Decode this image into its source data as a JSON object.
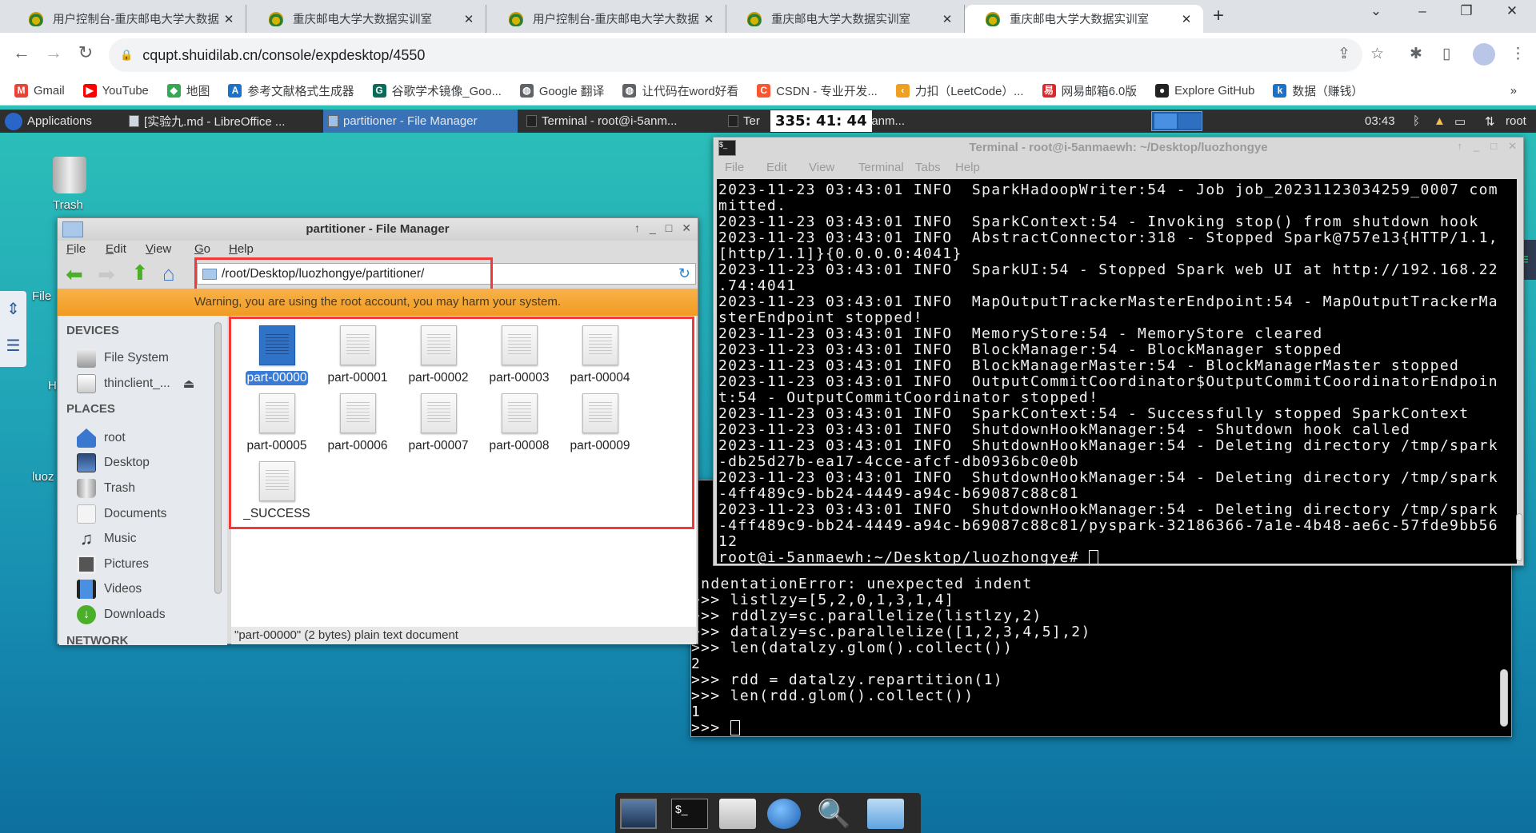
{
  "browser": {
    "tabs": [
      {
        "title": "用户控制台-重庆邮电大学大数据",
        "active": false
      },
      {
        "title": "重庆邮电大学大数据实训室",
        "active": false
      },
      {
        "title": "用户控制台-重庆邮电大学大数据",
        "active": false
      },
      {
        "title": "重庆邮电大学大数据实训室",
        "active": false
      },
      {
        "title": "重庆邮电大学大数据实训室",
        "active": true
      }
    ],
    "new_tab": "+",
    "url": "cqupt.shuidilab.cn/console/expdesktop/4550",
    "bookmarks": [
      {
        "label": "Gmail",
        "icon": "gmail-icon",
        "color": "#ea4335",
        "glyph": "M"
      },
      {
        "label": "YouTube",
        "icon": "youtube-icon",
        "color": "#ff0000",
        "glyph": "▶"
      },
      {
        "label": "地图",
        "icon": "maps-icon",
        "color": "#34a853",
        "glyph": "◆"
      },
      {
        "label": "参考文献格式生成器",
        "icon": "bookmark-a-icon",
        "color": "#1a73c8",
        "glyph": "A"
      },
      {
        "label": "谷歌学术镜像_Goo...",
        "icon": "bookmark-scholar-icon",
        "color": "#0b6b5a",
        "glyph": "G"
      },
      {
        "label": "Google 翻译",
        "icon": "globe-icon",
        "color": "#5f6368",
        "glyph": "◍"
      },
      {
        "label": "让代码在word好看",
        "icon": "globe-icon",
        "color": "#5f6368",
        "glyph": "◍"
      },
      {
        "label": "CSDN - 专业开发...",
        "icon": "csdn-icon",
        "color": "#fc5531",
        "glyph": "C"
      },
      {
        "label": "力扣（LeetCode）...",
        "icon": "leetcode-icon",
        "color": "#f0a020",
        "glyph": "‹"
      },
      {
        "label": "网易邮箱6.0版",
        "icon": "netease-mail-icon",
        "color": "#e0262a",
        "glyph": "易"
      },
      {
        "label": "Explore GitHub",
        "icon": "github-icon",
        "color": "#222222",
        "glyph": "●"
      },
      {
        "label": "数据（赚钱）",
        "icon": "bookmark-k-icon",
        "color": "#1a73c8",
        "glyph": "k"
      }
    ],
    "more_bookmarks": "»"
  },
  "panel": {
    "applications": "Applications",
    "tasks": [
      {
        "label": "[实验九.md - LibreOffice ...",
        "active": false
      },
      {
        "label": "partitioner - File Manager",
        "active": true
      },
      {
        "label": "Terminal - root@i-5anm...",
        "active": false
      },
      {
        "label": "Ter",
        "active": false
      }
    ],
    "task_tail": "-5anm...",
    "timer": "335: 41: 44",
    "clock": "03:43",
    "user": "root"
  },
  "desktop": {
    "icons": [
      {
        "label": "Trash"
      },
      {
        "label": "File"
      },
      {
        "label": "H"
      },
      {
        "label": "luoz"
      }
    ]
  },
  "file_manager": {
    "title": "partitioner - File Manager",
    "menu": [
      "File",
      "Edit",
      "View",
      "Go",
      "Help"
    ],
    "location": "/root/Desktop/luozhongye/partitioner/",
    "warning": "Warning, you are using the root account, you may harm your system.",
    "sidebar": {
      "devices_header": "DEVICES",
      "devices": [
        {
          "label": "File System",
          "icon": "harddisk-icon"
        },
        {
          "label": "thinclient_...",
          "icon": "drive-icon"
        }
      ],
      "places_header": "PLACES",
      "places": [
        {
          "label": "root",
          "icon": "home-icon"
        },
        {
          "label": "Desktop",
          "icon": "desktop-icon"
        },
        {
          "label": "Trash",
          "icon": "trash-icon"
        },
        {
          "label": "Documents",
          "icon": "document-icon"
        },
        {
          "label": "Music",
          "icon": "music-icon"
        },
        {
          "label": "Pictures",
          "icon": "pictures-icon"
        },
        {
          "label": "Videos",
          "icon": "videos-icon"
        },
        {
          "label": "Downloads",
          "icon": "downloads-icon"
        }
      ],
      "network_header": "NETWORK"
    },
    "files": [
      "part-00000",
      "part-00001",
      "part-00002",
      "part-00003",
      "part-00004",
      "part-00005",
      "part-00006",
      "part-00007",
      "part-00008",
      "part-00009",
      "_SUCCESS"
    ],
    "selected_file": "part-00000",
    "status": "\"part-00000\" (2 bytes) plain text document"
  },
  "terminal_front": {
    "title": "Terminal - root@i-5anmaewh: ~/Desktop/luozhongye",
    "menu": [
      "File",
      "Edit",
      "View",
      "Terminal",
      "Tabs",
      "Help"
    ],
    "lines": [
      "2023-11-23 03:43:01 INFO  SparkHadoopWriter:54 - Job job_20231123034259_0007 com",
      "mitted.",
      "2023-11-23 03:43:01 INFO  SparkContext:54 - Invoking stop() from shutdown hook",
      "2023-11-23 03:43:01 INFO  AbstractConnector:318 - Stopped Spark@757e13{HTTP/1.1,",
      "[http/1.1]}{0.0.0.0:4041}",
      "2023-11-23 03:43:01 INFO  SparkUI:54 - Stopped Spark web UI at http://192.168.22",
      ".74:4041",
      "2023-11-23 03:43:01 INFO  MapOutputTrackerMasterEndpoint:54 - MapOutputTrackerMa",
      "sterEndpoint stopped!",
      "2023-11-23 03:43:01 INFO  MemoryStore:54 - MemoryStore cleared",
      "2023-11-23 03:43:01 INFO  BlockManager:54 - BlockManager stopped",
      "2023-11-23 03:43:01 INFO  BlockManagerMaster:54 - BlockManagerMaster stopped",
      "2023-11-23 03:43:01 INFO  OutputCommitCoordinator$OutputCommitCoordinatorEndpoin",
      "t:54 - OutputCommitCoordinator stopped!",
      "2023-11-23 03:43:01 INFO  SparkContext:54 - Successfully stopped SparkContext",
      "2023-11-23 03:43:01 INFO  ShutdownHookManager:54 - Shutdown hook called",
      "2023-11-23 03:43:01 INFO  ShutdownHookManager:54 - Deleting directory /tmp/spark",
      "-db25d27b-ea17-4cce-afcf-db0936bc0e0b",
      "2023-11-23 03:43:01 INFO  ShutdownHookManager:54 - Deleting directory /tmp/spark",
      "-4ff489c9-bb24-4449-a94c-b69087c88c81",
      "2023-11-23 03:43:01 INFO  ShutdownHookManager:54 - Deleting directory /tmp/spark",
      "-4ff489c9-bb24-4449-a94c-b69087c88c81/pyspark-32186366-7a1e-4b48-ae6c-57fde9bb56",
      "12"
    ],
    "prompt": "root@i-5anmaewh:~/Desktop/luozhongye# "
  },
  "terminal_back": {
    "lines": [
      "IndentationError: unexpected indent",
      ">>> listlzy=[5,2,0,1,3,1,4]",
      ">>> rddlzy=sc.parallelize(listlzy,2)",
      ">>> datalzy=sc.parallelize([1,2,3,4,5],2)",
      ">>> len(datalzy.glom().collect())",
      "2",
      ">>> rdd = datalzy.repartition(1)",
      ">>> len(rdd.glom().collect())",
      "1"
    ],
    "prompt": ">>> "
  },
  "dock": [
    "screen-icon",
    "terminal-icon",
    "home-folder-icon",
    "web-browser-icon",
    "search-icon",
    "folder-icon"
  ]
}
